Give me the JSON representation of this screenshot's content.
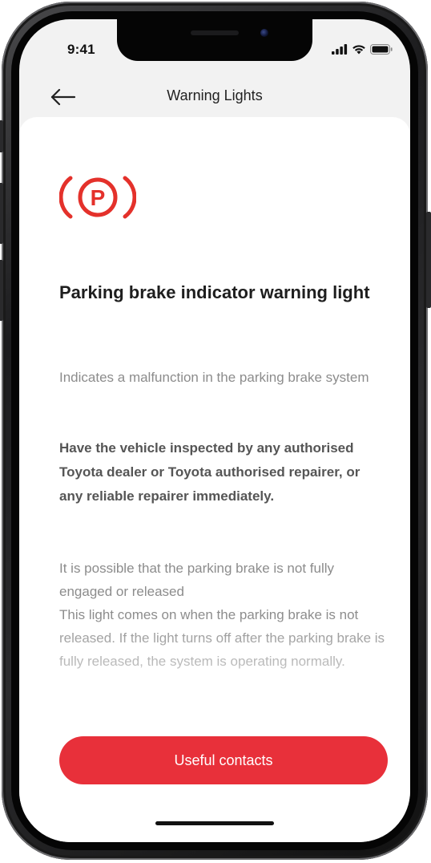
{
  "status_bar": {
    "time": "9:41"
  },
  "header": {
    "back_icon": "arrow-left-icon",
    "title": "Warning Lights"
  },
  "warning": {
    "icon": "parking-brake-warning-icon",
    "icon_color": "#e4312b",
    "title": "Parking brake indicator warning light",
    "description": "Indicates a malfunction in the parking brake system",
    "advice": "Have the vehicle inspected by any authorised Toyota dealer or Toyota authorised repairer, or any reliable repairer immediately.",
    "details": "It is possible that the parking brake is not fully engaged or released\nThis light comes on when the parking brake is not released. If the light turns off after the parking brake is fully released, the system is operating normally."
  },
  "actions": {
    "useful_contacts_label": "Useful contacts",
    "accent_color": "#e8303a"
  }
}
